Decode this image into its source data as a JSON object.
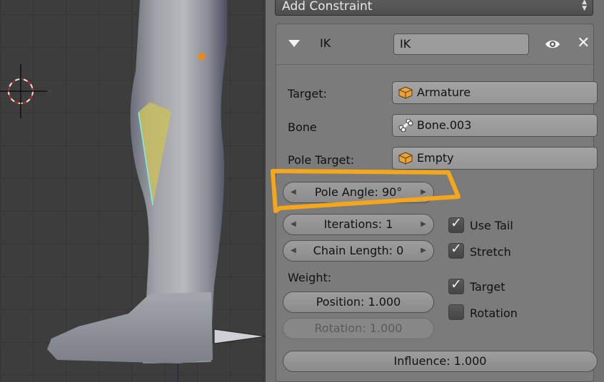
{
  "panel": {
    "add_constraint_label": "Add Constraint",
    "constraint": {
      "type_label": "IK",
      "name_value": "IK",
      "target": {
        "label": "Target:",
        "value": "Armature",
        "icon": "object-cube-icon"
      },
      "bone": {
        "label": "Bone",
        "value": "Bone.003",
        "icon": "bone-icon"
      },
      "pole_target": {
        "label": "Pole Target:",
        "value": "Empty",
        "icon": "object-cube-icon"
      },
      "pole_angle": "Pole Angle: 90°",
      "iterations": "Iterations: 1",
      "chain_length": "Chain Length: 0",
      "use_tail": {
        "label": "Use Tail",
        "checked": true
      },
      "stretch": {
        "label": "Stretch",
        "checked": true
      },
      "weight_label": "Weight:",
      "position": "Position: 1.000",
      "rotation_weight": "Rotation: 1.000",
      "target_toggle": {
        "label": "Target",
        "checked": true
      },
      "rotation_toggle": {
        "label": "Rotation",
        "checked": false
      },
      "influence": "Influence: 1.000"
    }
  },
  "colors": {
    "highlight": "#f5a71b",
    "panel_bg": "#727272",
    "viewport_bg": "#3d3d3d"
  }
}
